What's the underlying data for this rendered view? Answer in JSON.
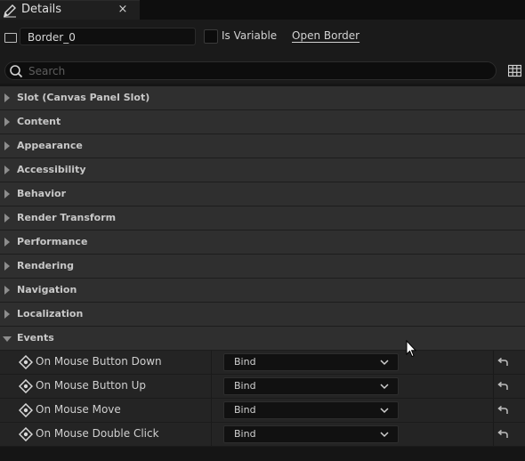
{
  "tab": {
    "title": "Details",
    "close": "×"
  },
  "header": {
    "widget_name": "Border_0",
    "is_variable_label": "Is Variable",
    "open_link": "Open Border"
  },
  "search": {
    "placeholder": "Search",
    "value": ""
  },
  "categories": [
    {
      "label": "Slot (Canvas Panel Slot)",
      "expanded": false
    },
    {
      "label": "Content",
      "expanded": false
    },
    {
      "label": "Appearance",
      "expanded": false
    },
    {
      "label": "Accessibility",
      "expanded": false
    },
    {
      "label": "Behavior",
      "expanded": false
    },
    {
      "label": "Render Transform",
      "expanded": false
    },
    {
      "label": "Performance",
      "expanded": false
    },
    {
      "label": "Rendering",
      "expanded": false
    },
    {
      "label": "Navigation",
      "expanded": false
    },
    {
      "label": "Localization",
      "expanded": false
    },
    {
      "label": "Events",
      "expanded": true
    }
  ],
  "events": [
    {
      "label": "On Mouse Button Down",
      "bind": "Bind"
    },
    {
      "label": "On Mouse Button Up",
      "bind": "Bind"
    },
    {
      "label": "On Mouse Move",
      "bind": "Bind"
    },
    {
      "label": "On Mouse Double Click",
      "bind": "Bind"
    }
  ],
  "icons": {
    "tab": "pencil-icon",
    "widget": "widget-frame-icon",
    "search": "search-icon",
    "view_options": "table-icon",
    "event": "event-diamond-icon",
    "dropdown": "chevron-down-icon",
    "reset": "reset-arrow-icon"
  },
  "colors": {
    "background": "#151515",
    "category_bg": "#2f2f2f",
    "event_bg": "#242424",
    "field_bg": "#0f0f0f",
    "text": "#c8c8c8"
  }
}
